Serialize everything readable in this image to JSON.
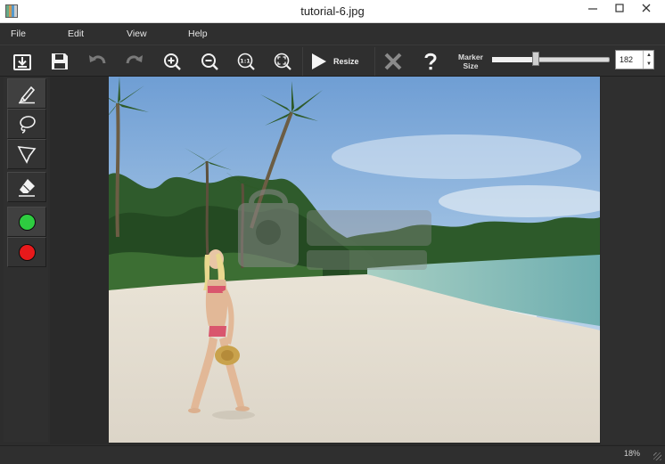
{
  "window": {
    "title": "tutorial-6.jpg"
  },
  "menu": {
    "items": [
      "File",
      "Edit",
      "View",
      "Help"
    ]
  },
  "toolbar": {
    "resize_label": "Resize",
    "marker_label_line1": "Marker",
    "marker_label_line2": "Size",
    "marker_size_value": "182",
    "marker_slider_fraction": 0.37
  },
  "status": {
    "zoom": "18%"
  },
  "colors": {
    "keep_marker": "#2ecc40",
    "remove_marker": "#e8191b",
    "background": "#2d2d2d"
  },
  "icons": {
    "toolbar": [
      "open-icon",
      "save-icon",
      "undo-icon",
      "redo-icon",
      "zoom-in-icon",
      "zoom-out-icon",
      "zoom-actual-size-icon",
      "zoom-fit-icon",
      "play-icon",
      "cancel-icon",
      "help-icon"
    ],
    "tools": [
      "marker-brush-icon",
      "lasso-icon",
      "polygon-lasso-icon",
      "eraser-icon",
      "keep-marker-dot",
      "remove-marker-dot"
    ]
  }
}
